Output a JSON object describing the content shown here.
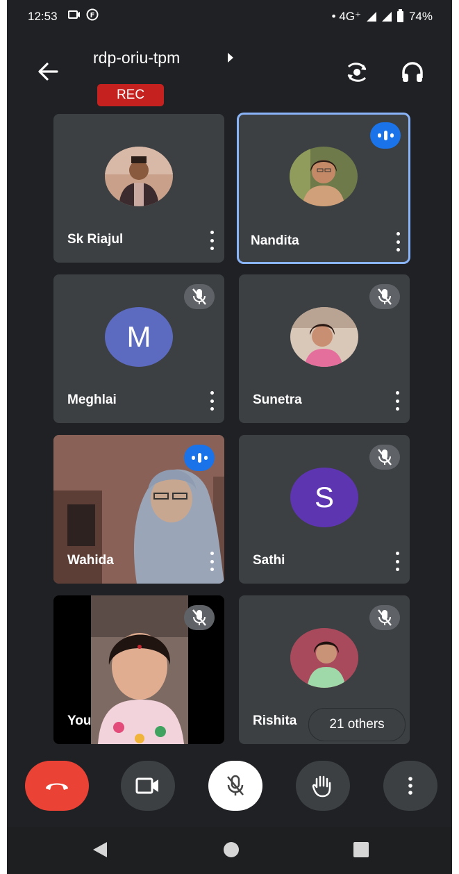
{
  "status_bar": {
    "time": "12:53",
    "network": "• 4G⁺",
    "battery": "74%"
  },
  "header": {
    "meeting_title": "rdp-oriu-tpm",
    "rec_label": "REC"
  },
  "participants": [
    {
      "name": "Sk Riajul",
      "state": "speaking-none"
    },
    {
      "name": "Nandita",
      "state": "speaking"
    },
    {
      "name": "Meghlai",
      "initial": "M",
      "color": "#5c6bc0",
      "state": "muted"
    },
    {
      "name": "Sunetra",
      "state": "muted"
    },
    {
      "name": "Wahida",
      "state": "speaking"
    },
    {
      "name": "Sathi",
      "initial": "S",
      "color": "#5e35b1",
      "state": "muted"
    },
    {
      "name": "You",
      "state": "muted"
    },
    {
      "name": "Rishita",
      "state": "muted"
    }
  ],
  "others_label": "21 others",
  "colors": {
    "background": "#202124",
    "tile": "#3c4043",
    "active_border": "#8ab4f8",
    "rec": "#c5221f",
    "end_call": "#ea4335",
    "speaking_badge": "#1a73e8"
  }
}
